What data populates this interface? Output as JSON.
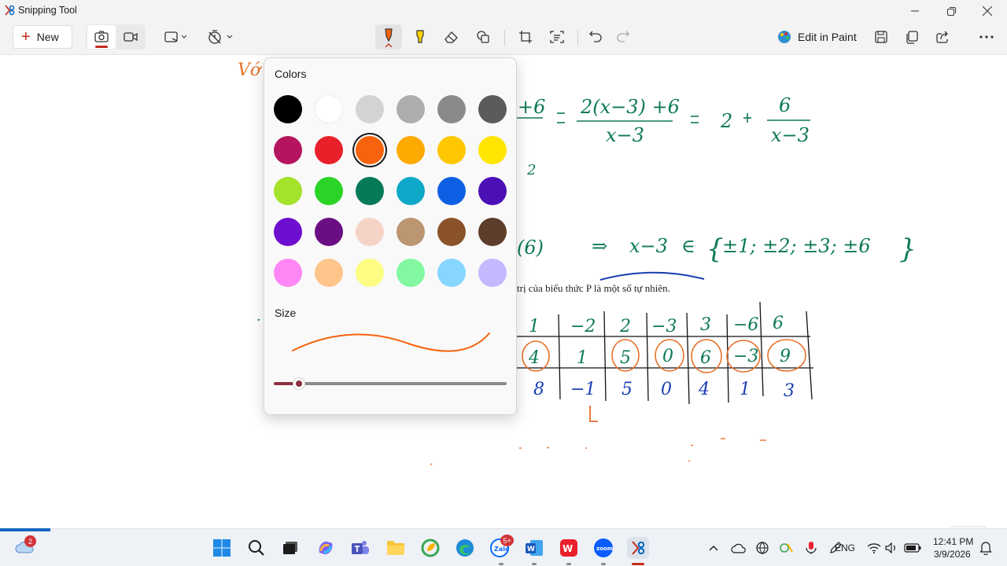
{
  "window": {
    "title": "Snipping Tool"
  },
  "toolbar": {
    "new_label": "New",
    "edit_in_paint_label": "Edit in Paint"
  },
  "popup": {
    "colors_header": "Colors",
    "size_header": "Size",
    "selected_color": "#f7630c",
    "swatches": [
      "#000000",
      "#ffffff",
      "#d3d3d3",
      "#adadad",
      "#8a8a8a",
      "#5d5a5b",
      "#b4155e",
      "#e8202a",
      "#f7630c",
      "#ffaa00",
      "#ffc700",
      "#ffe500",
      "#a4e22b",
      "#2ad426",
      "#067a58",
      "#10a8c9",
      "#0d5fe3",
      "#4b0fb6",
      "#6d0fcf",
      "#6b0e83",
      "#f6d4c5",
      "#bc9670",
      "#8a5229",
      "#5d3d2b",
      "#ff87f5",
      "#ffc58b",
      "#fdfd84",
      "#82f8a1",
      "#86d6ff",
      "#c5b8ff"
    ],
    "size_level_percent": 8
  },
  "canvas": {
    "caption": "trị của biểu thức  P  là một số tự nhiên.",
    "caption_var": "P",
    "ink_colors": {
      "green": "#0e7a55",
      "blue": "#1a3fb0",
      "orange": "#e6712a"
    }
  },
  "taskbar": {
    "weather_badge": "2",
    "zalo_badge": "5+",
    "language": "ENG",
    "time": "12:41 PM",
    "date": "3/9/2026"
  }
}
